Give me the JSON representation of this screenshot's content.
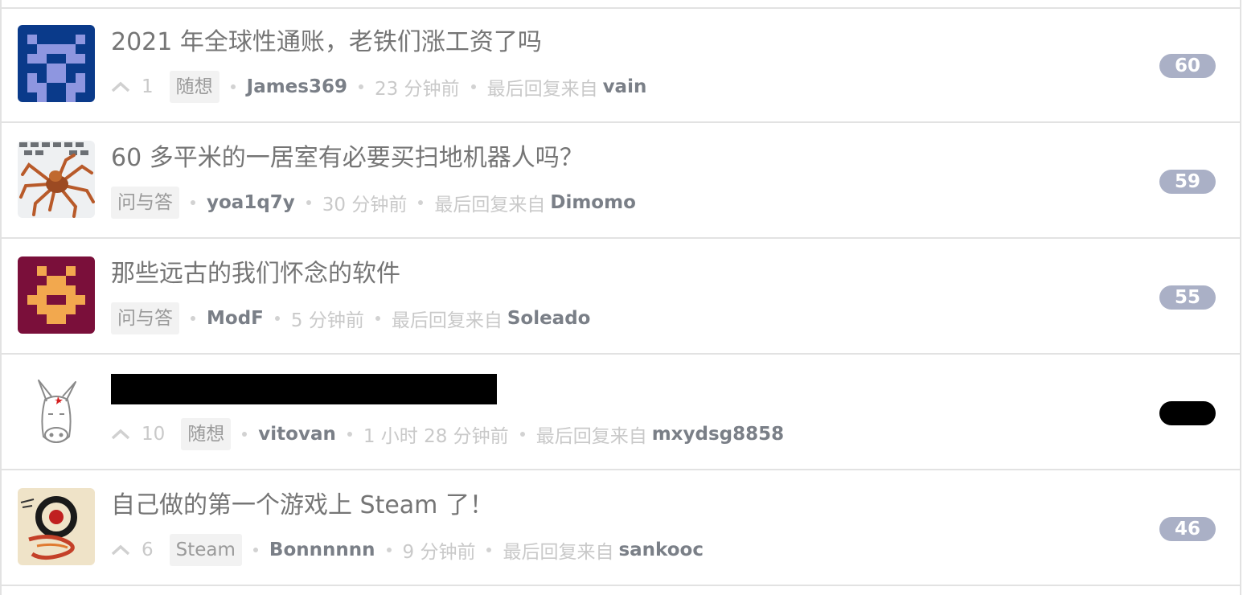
{
  "topics": [
    {
      "title": "2021 年全球性通账，老铁们涨工资了吗",
      "votes": "1",
      "node": "随想",
      "author": "James369",
      "time": "23 分钟前",
      "last_reply_label": "最后回复来自",
      "last_reply_user": "vain",
      "replies": "60"
    },
    {
      "title": "60 多平米的一居室有必要买扫地机器人吗？",
      "node": "问与答",
      "author": "yoa1q7y",
      "time": "30 分钟前",
      "last_reply_label": "最后回复来自",
      "last_reply_user": "Dimomo",
      "replies": "59"
    },
    {
      "title": "那些远古的我们怀念的软件",
      "node": "问与答",
      "author": "ModF",
      "time": "5 分钟前",
      "last_reply_label": "最后回复来自",
      "last_reply_user": "Soleado",
      "replies": "55"
    },
    {
      "votes": "10",
      "node": "随想",
      "author": "vitovan",
      "time": "1 小时 28 分钟前",
      "last_reply_label": "最后回复来自",
      "last_reply_user": "mxydsg8858"
    },
    {
      "title": "自己做的第一个游戏上 Steam 了！",
      "votes": "6",
      "node": "Steam",
      "author": "Bonnnnnn",
      "time": "9 分钟前",
      "last_reply_label": "最后回复来自",
      "last_reply_user": "sankooc",
      "replies": "46"
    }
  ],
  "colors": {
    "badge": "#aab0c6",
    "title": "#757575",
    "author": "#7a7f87",
    "meta": "#c9c9c9"
  }
}
